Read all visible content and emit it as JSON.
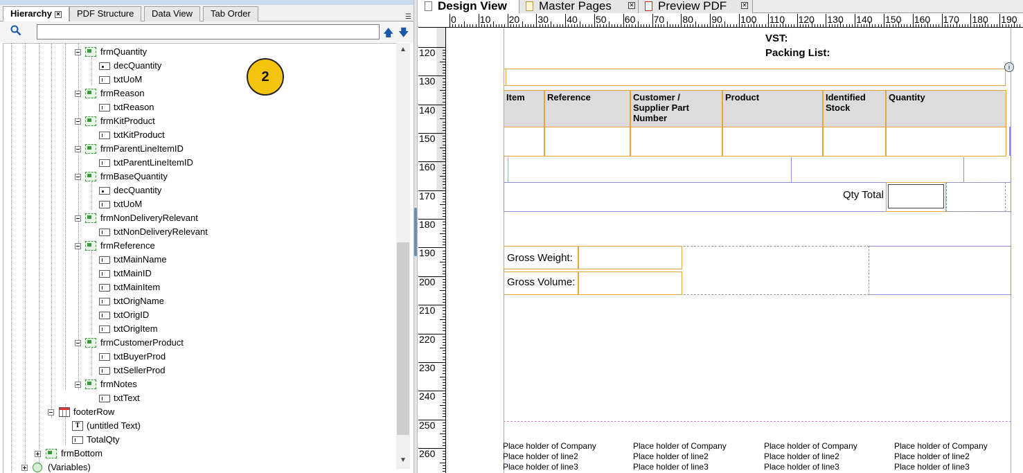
{
  "left_panel": {
    "tabs": [
      {
        "label": "Hierarchy",
        "active": true
      },
      {
        "label": "PDF Structure"
      },
      {
        "label": "Data View"
      },
      {
        "label": "Tab Order"
      }
    ],
    "search": {
      "value": "",
      "placeholder": ""
    },
    "tree": [
      {
        "label": "frmQuantity",
        "icon": "subform-icon"
      },
      {
        "label": "decQuantity",
        "icon": "decimal-field-icon"
      },
      {
        "label": "txtUoM",
        "icon": "text-field-icon"
      },
      {
        "label": "frmReason",
        "icon": "subform-icon"
      },
      {
        "label": "txtReason",
        "icon": "text-field-icon"
      },
      {
        "label": "frmKitProduct",
        "icon": "subform-icon"
      },
      {
        "label": "txtKitProduct",
        "icon": "text-field-icon"
      },
      {
        "label": "frmParentLineItemID",
        "icon": "subform-icon"
      },
      {
        "label": "txtParentLineItemID",
        "icon": "text-field-icon"
      },
      {
        "label": "frmBaseQuantity",
        "icon": "subform-icon"
      },
      {
        "label": "decQuantity",
        "icon": "decimal-field-icon"
      },
      {
        "label": "txtUoM",
        "icon": "text-field-icon"
      },
      {
        "label": "frmNonDeliveryRelevant",
        "icon": "subform-icon"
      },
      {
        "label": "txtNonDeliveryRelevant",
        "icon": "text-field-icon"
      },
      {
        "label": "frmReference",
        "icon": "subform-icon"
      },
      {
        "label": "txtMainName",
        "icon": "text-field-icon"
      },
      {
        "label": "txtMainID",
        "icon": "text-field-icon"
      },
      {
        "label": "txtMainItem",
        "icon": "text-field-icon"
      },
      {
        "label": "txtOrigName",
        "icon": "text-field-icon"
      },
      {
        "label": "txtOrigID",
        "icon": "text-field-icon"
      },
      {
        "label": "txtOrigItem",
        "icon": "text-field-icon"
      },
      {
        "label": "frmCustomerProduct",
        "icon": "subform-icon"
      },
      {
        "label": "txtBuyerProd",
        "icon": "text-field-icon"
      },
      {
        "label": "txtSellerProd",
        "icon": "text-field-icon"
      },
      {
        "label": "frmNotes",
        "icon": "subform-icon"
      },
      {
        "label": "txtText",
        "icon": "text-field-icon"
      },
      {
        "label": "footerRow",
        "icon": "table-row-icon"
      },
      {
        "label": "(untitled Text)",
        "icon": "static-text-icon"
      },
      {
        "label": "TotalQty",
        "icon": "text-field-icon"
      },
      {
        "label": "frmBottom",
        "icon": "subform-icon"
      },
      {
        "label": "(Variables)",
        "icon": "variables-icon"
      }
    ],
    "callout": "2"
  },
  "right_panel": {
    "tabs": [
      {
        "label": "Design View",
        "active": true
      },
      {
        "label": "Master Pages"
      },
      {
        "label": "Preview PDF"
      }
    ],
    "ruler_h": [
      "0",
      "10",
      "20",
      "30",
      "40",
      "50",
      "60",
      "70",
      "80",
      "90",
      "100",
      "110",
      "120",
      "130",
      "140",
      "150",
      "160",
      "170",
      "180",
      "190"
    ],
    "ruler_v": [
      "120",
      "130",
      "140",
      "150",
      "160",
      "170",
      "180",
      "190",
      "200",
      "210",
      "220",
      "230",
      "240",
      "250",
      "260"
    ],
    "form": {
      "vst_label": "VST:",
      "packing_list_label": "Packing List:",
      "columns": [
        "Item",
        "Reference",
        "Customer /\nSupplier Part\nNumber",
        "Product",
        "Identified\nStock",
        "Quantity"
      ],
      "qty_total_label": "Qty Total",
      "gross_weight_label": "Gross Weight:",
      "gross_volume_label": "Gross Volume:",
      "footer_blocks": [
        {
          "line1": "Place holder of Company",
          "line2": "Place holder of line2",
          "line3": "Place holder of line3"
        },
        {
          "line1": "Place holder of Company",
          "line2": "Place holder of line2",
          "line3": "Place holder of line3"
        },
        {
          "line1": "Place holder of Company",
          "line2": "Place holder of line2",
          "line3": "Place holder of line3"
        },
        {
          "line1": "Place holder of Company",
          "line2": "Place holder of line2",
          "line3": "Place holder of line3"
        }
      ]
    }
  }
}
